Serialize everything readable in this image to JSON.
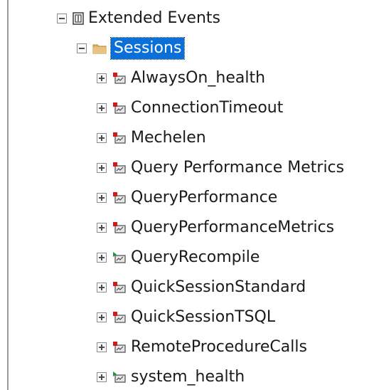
{
  "tree": {
    "root": {
      "label": "Extended Events",
      "icon": "extended-events-icon",
      "expanded": true
    },
    "folder": {
      "label": "Sessions",
      "icon": "folder-icon",
      "expanded": true,
      "selected": true,
      "selection_color": "#0a6fd6"
    },
    "sessions": [
      {
        "label": "AlwaysOn_health",
        "status": "stopped"
      },
      {
        "label": "ConnectionTimeout",
        "status": "stopped"
      },
      {
        "label": "Mechelen",
        "status": "stopped"
      },
      {
        "label": "Query Performance Metrics",
        "status": "stopped"
      },
      {
        "label": "QueryPerformance",
        "status": "stopped"
      },
      {
        "label": "QueryPerformanceMetrics",
        "status": "stopped"
      },
      {
        "label": "QueryRecompile",
        "status": "running"
      },
      {
        "label": "QuickSessionStandard",
        "status": "stopped"
      },
      {
        "label": "QuickSessionTSQL",
        "status": "stopped"
      },
      {
        "label": "RemoteProcedureCalls",
        "status": "stopped"
      },
      {
        "label": "system_health",
        "status": "running"
      }
    ],
    "status_colors": {
      "stopped": "#d11a1a",
      "running": "#1f9a3a"
    }
  }
}
